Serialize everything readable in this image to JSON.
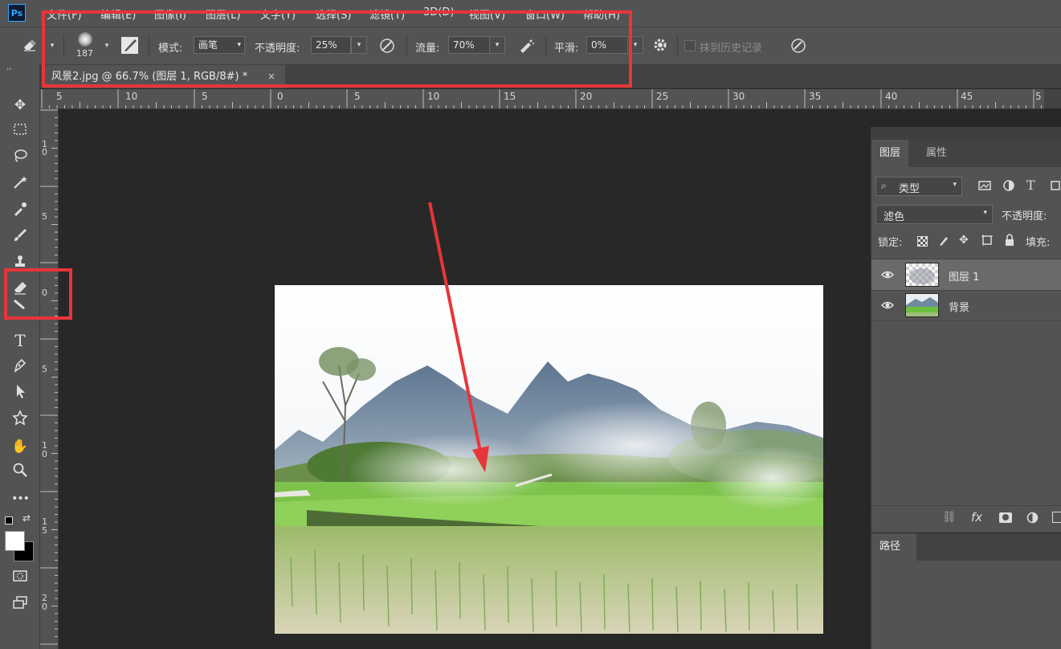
{
  "app": {
    "logo": "Ps"
  },
  "menu": [
    "文件(F)",
    "编辑(E)",
    "图像(I)",
    "图层(L)",
    "文字(Y)",
    "选择(S)",
    "滤镜(T)",
    "3D(D)",
    "视图(V)",
    "窗口(W)",
    "帮助(H)"
  ],
  "options": {
    "brush_size": "187",
    "mode_label": "模式:",
    "mode_value": "画笔",
    "opacity_label": "不透明度:",
    "opacity_value": "25%",
    "flow_label": "流量:",
    "flow_value": "70%",
    "smooth_label": "平滑:",
    "smooth_value": "0%",
    "erase_history_label": "抹到历史记录"
  },
  "document": {
    "tab_title": "风景2.jpg @ 66.7% (图层 1, RGB/8#) *",
    "close_glyph": "×"
  },
  "ruler": {
    "h_labels": [
      "5",
      "10",
      "5",
      "0",
      "5",
      "10",
      "15",
      "20",
      "25",
      "30",
      "35",
      "40",
      "45",
      "5"
    ],
    "v_labels": [
      "1",
      "0",
      "5",
      "0",
      "5",
      "1",
      "0",
      "1",
      "5",
      "2",
      "0"
    ]
  },
  "layers_panel": {
    "tabs": [
      "图层",
      "属性"
    ],
    "filter_kind": "类型",
    "blend_mode": "滤色",
    "opacity_label": "不透明度:",
    "lock_label": "锁定:",
    "fill_label": "填充:",
    "layers": [
      {
        "name": "图层 1",
        "selected": true
      },
      {
        "name": "背景",
        "selected": false
      }
    ],
    "footer_fx": "fx"
  },
  "paths_panel": {
    "tab": "路径"
  },
  "colors": {
    "highlight": "#e8353a",
    "foreground": "#ffffff",
    "background": "#000000"
  }
}
